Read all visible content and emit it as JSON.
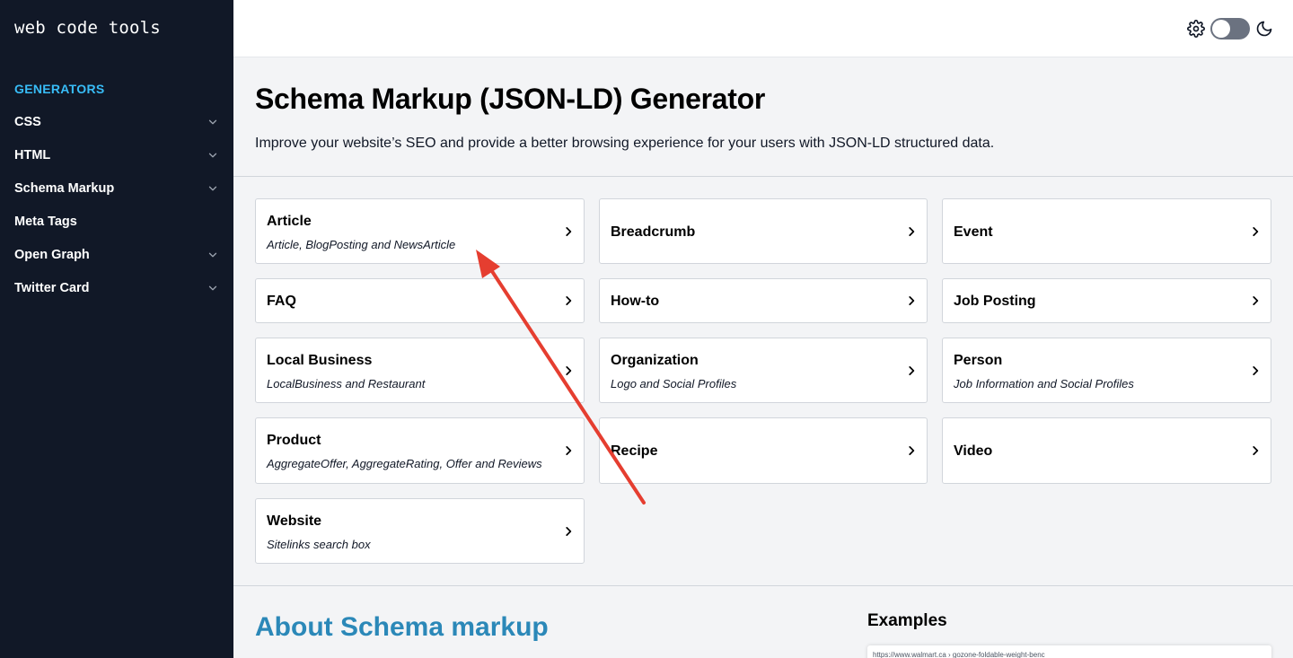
{
  "sidebar": {
    "logo": "web code tools",
    "heading": "GENERATORS",
    "items": [
      {
        "label": "CSS",
        "expandable": true
      },
      {
        "label": "HTML",
        "expandable": true
      },
      {
        "label": "Schema Markup",
        "expandable": true
      },
      {
        "label": "Meta Tags",
        "expandable": false
      },
      {
        "label": "Open Graph",
        "expandable": true
      },
      {
        "label": "Twitter Card",
        "expandable": true
      }
    ]
  },
  "topbar": {
    "icons": [
      "gear-icon",
      "theme-toggle",
      "moon-icon"
    ],
    "dark_mode": false
  },
  "hero": {
    "title": "Schema Markup (JSON-LD) Generator",
    "description": "Improve your website’s SEO and provide a better browsing experience for your users with JSON-LD structured data."
  },
  "cards": [
    {
      "title": "Article",
      "subtitle": "Article, BlogPosting and NewsArticle"
    },
    {
      "title": "Breadcrumb",
      "subtitle": ""
    },
    {
      "title": "Event",
      "subtitle": ""
    },
    {
      "title": "FAQ",
      "subtitle": ""
    },
    {
      "title": "How-to",
      "subtitle": ""
    },
    {
      "title": "Job Posting",
      "subtitle": ""
    },
    {
      "title": "Local Business",
      "subtitle": "LocalBusiness and Restaurant"
    },
    {
      "title": "Organization",
      "subtitle": "Logo and Social Profiles"
    },
    {
      "title": "Person",
      "subtitle": "Job Information and Social Profiles"
    },
    {
      "title": "Product",
      "subtitle": "AggregateOffer, AggregateRating, Offer and Reviews"
    },
    {
      "title": "Recipe",
      "subtitle": ""
    },
    {
      "title": "Video",
      "subtitle": ""
    },
    {
      "title": "Website",
      "subtitle": "Sitelinks search box"
    }
  ],
  "about": {
    "title": "About Schema markup"
  },
  "examples": {
    "title": "Examples",
    "thumb_url": "https://www.walmart.ca › gozone-foldable-weight-benc"
  },
  "colors": {
    "sidebar_bg": "#111827",
    "accent": "#38bdf8",
    "about_title": "#2b88b8",
    "annotation_arrow": "#e53e30"
  }
}
